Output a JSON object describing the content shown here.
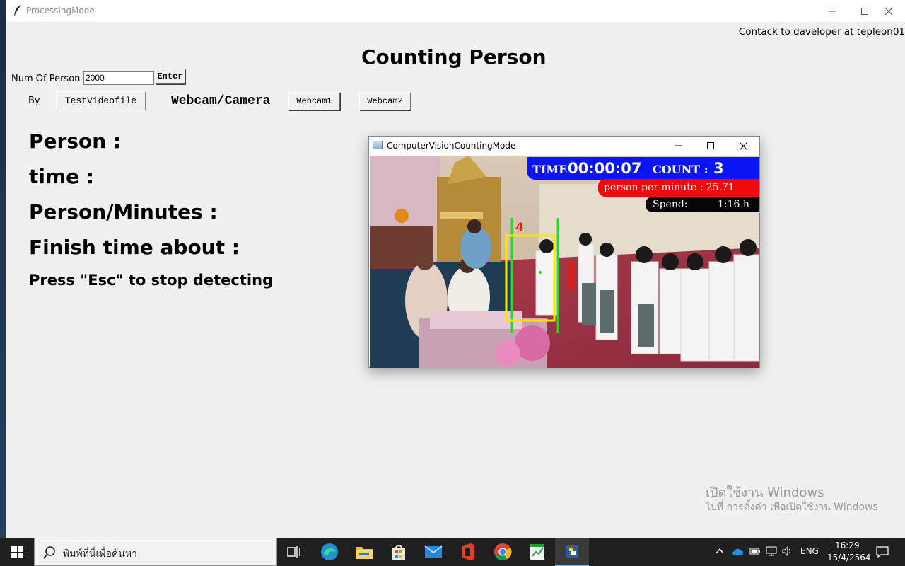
{
  "main_window": {
    "title": "ProcessingMode",
    "contact": "Contack to daveloper at tepleon01",
    "heading": "Counting Person",
    "num_of_person_label": "Num Of Person",
    "num_of_person_value": "2000",
    "enter_label": "Enter",
    "by_label": "By",
    "test_video_label": "TestVideofile",
    "webcam_camera_label": "Webcam/Camera",
    "webcam1_label": "Webcam1",
    "webcam2_label": "Webcam2",
    "stats": {
      "person": "Person :",
      "time": "time :",
      "person_per_minutes": "Person/Minutes :",
      "finish_time": "Finish time about :",
      "esc_hint": "Press \"Esc\" to stop detecting"
    }
  },
  "cv_window": {
    "title": "ComputerVisionCountingMode",
    "overlay": {
      "time_label": "TIME",
      "time_value": "00:00:07",
      "count_label": "COUNT :",
      "count_value": "3",
      "person_per_minute": "person per minute : 25.71",
      "spend_label": "Spend:",
      "spend_value": "1:16 h",
      "track_id": "4"
    }
  },
  "activation_watermark": {
    "line1": "เปิดใช้งาน Windows",
    "line2": "ไปที่ การตั้งค่า เพื่อเปิดใช้งาน Windows"
  },
  "taskbar": {
    "search_placeholder": "พิมพ์ที่นี่เพื่อค้นหา",
    "language": "ENG",
    "time": "16:29",
    "date": "15/4/2564"
  },
  "colors": {
    "overlay_blue": "#0b14f2",
    "overlay_red": "#f00a0a",
    "count_line": "#22dd22",
    "detect_box": "#ffe600"
  }
}
